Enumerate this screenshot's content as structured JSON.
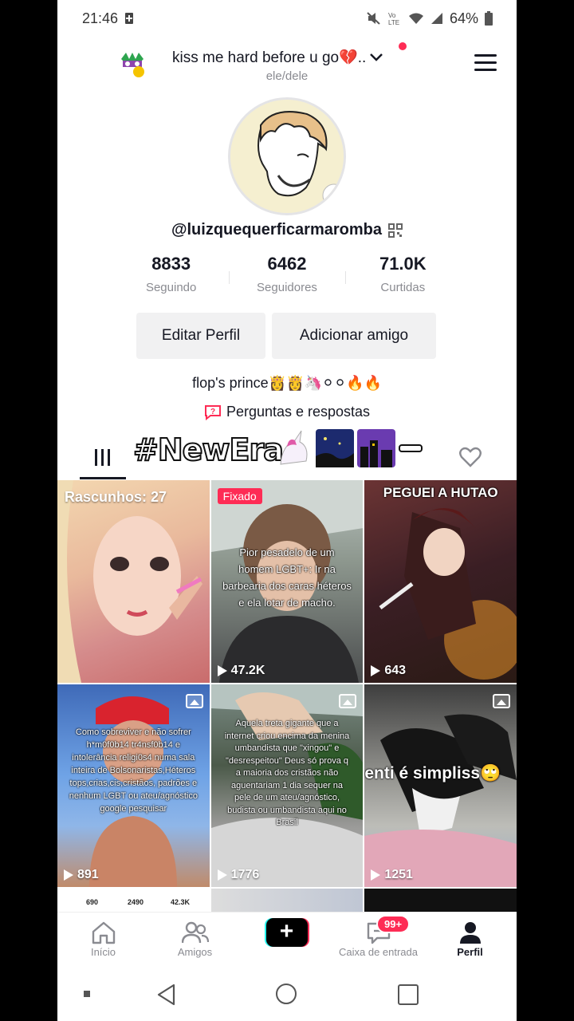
{
  "status_bar": {
    "time": "21:46",
    "battery": "64%"
  },
  "header": {
    "title": "kiss me hard before u go💔..",
    "pronoun": "ele/dele"
  },
  "profile": {
    "username": "@luizquequerficarmaromba",
    "stats": [
      {
        "value": "8833",
        "label": "Seguindo"
      },
      {
        "value": "6462",
        "label": "Seguidores"
      },
      {
        "value": "71.0K",
        "label": "Curtidas"
      }
    ],
    "edit_button": "Editar Perfil",
    "add_friend_button": "Adicionar amigo",
    "bio": "flop's prince👸👸🦄⚪⚪🔥🔥",
    "qa_label": "Perguntas e respostas"
  },
  "overlay_sticker": {
    "text": "#NewEra"
  },
  "grid": {
    "drafts_label": "Rascunhos: 27",
    "pinned_label": "Fixado",
    "items": [
      {
        "views": ""
      },
      {
        "views": "47.2K",
        "caption": "Pior pesadelo de um homem LGBT+: Ir na barbearia dos caras héteros e ela lotar de macho."
      },
      {
        "views": "643",
        "caption": "PEGUEI A HUTAO"
      },
      {
        "views": "891",
        "caption": "Como sobreviver e não sofrer h*m0f0b14 tr4nsf0b14 e intolerância religi0s4 numa sala inteira de Bolsonaristas,Héteros tops,crias,cis,cristãos, padrões e nenhum LGBT ou ateu/agnóstico google pesquisar"
      },
      {
        "views": "1776",
        "caption": "Aquela treta gigante que a internet criou encima da menina umbandista que \"xingou\" e \"desrespeitou\" Deus só prova q a maioria dos cristãos não aguentariam 1 dia sequer na pele de um ateu/agnóstico, budista ou umbandista aqui no Brasil"
      },
      {
        "views": "1251",
        "caption": "enti é simpliss🙄"
      }
    ],
    "partial_row_numbers": [
      "690",
      "2490",
      "42.3K"
    ]
  },
  "bottom_nav": {
    "items": [
      {
        "label": "Início"
      },
      {
        "label": "Amigos"
      },
      {
        "label": ""
      },
      {
        "label": "Caixa de entrada",
        "badge": "99+"
      },
      {
        "label": "Perfil"
      }
    ]
  },
  "colors": {
    "accent": "#fe2c55",
    "cyan": "#25f4ee",
    "text": "#161823",
    "muted": "#8a8b91"
  }
}
